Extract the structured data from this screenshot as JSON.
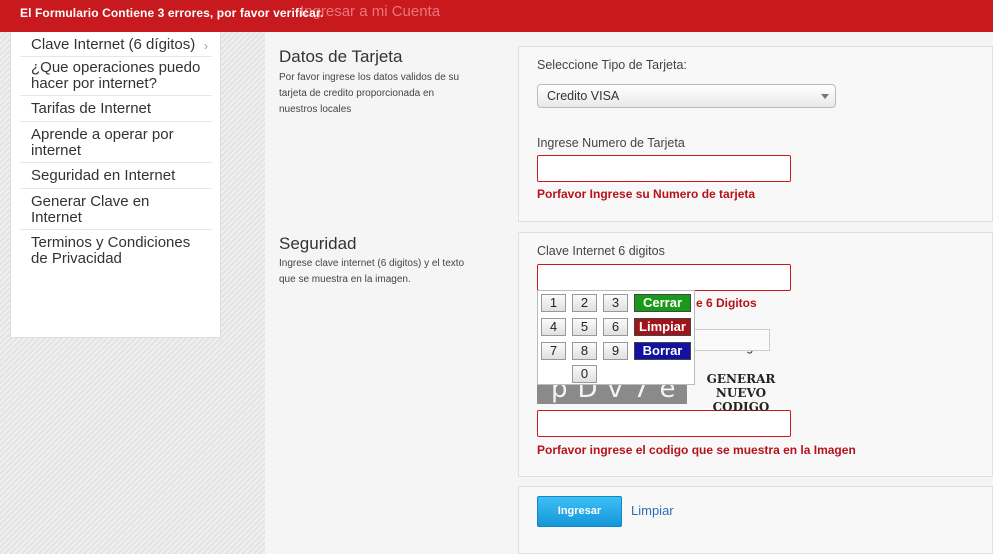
{
  "topbar": {
    "error_message": "El Formulario Contiene 3 errores, por favor verificar.",
    "behind_text": "Ingresar a mi Cuenta"
  },
  "sidebar": {
    "items": [
      {
        "label": "Clave Internet (6 dígitos)",
        "has_chevron": true
      },
      {
        "label": "¿Que operaciones puedo hacer por internet?"
      },
      {
        "label": "Tarifas de Internet"
      },
      {
        "label": "Aprende a operar por internet"
      },
      {
        "label": "Seguridad en Internet"
      },
      {
        "label": "Generar Clave en Internet"
      },
      {
        "label": "Terminos y Condiciones de Privacidad"
      }
    ],
    "chevron": "›"
  },
  "tarjeta": {
    "title": "Datos de Tarjeta",
    "description": "Por favor ingrese los datos validos de su tarjeta de credito proporcionada en nuestros locales",
    "select_label": "Seleccione Tipo de Tarjeta:",
    "select_value": "Credito VISA",
    "number_label": "Ingrese Numero de Tarjeta",
    "number_value": "",
    "number_error": "Porfavor Ingrese su Numero de tarjeta"
  },
  "seguridad": {
    "title": "Seguridad",
    "description": "Ingrese clave internet (6 digitos) y el texto que se muestra en la imagen.",
    "clave_label": "Clave Internet 6 digitos",
    "clave_value": "",
    "clave_error_partial": "e 6 Digitos",
    "image_label_partial": "de la Imagen",
    "captcha_text": "pDv7ee",
    "new_code_label_1": "GENERAR",
    "new_code_label_2": "NUEVO CODIGO",
    "captcha_value": "",
    "captcha_error": "Porfavor ingrese el codigo que se muestra en la Imagen"
  },
  "keypad": {
    "keys": [
      "1",
      "2",
      "3",
      "4",
      "5",
      "6",
      "7",
      "8",
      "9",
      "0"
    ],
    "cerrar": "Cerrar",
    "limpiar": "Limpiar",
    "borrar": "Borrar",
    "colors": {
      "cerrar": "#1a9a1a",
      "limpiar": "#a0141b",
      "borrar": "#1212a0"
    }
  },
  "actions": {
    "submit": "Ingresar",
    "reset": "Limpiar"
  },
  "colors": {
    "brand_red": "#c8191e",
    "error_red": "#b5121b",
    "accent_blue": "#1596d9"
  }
}
